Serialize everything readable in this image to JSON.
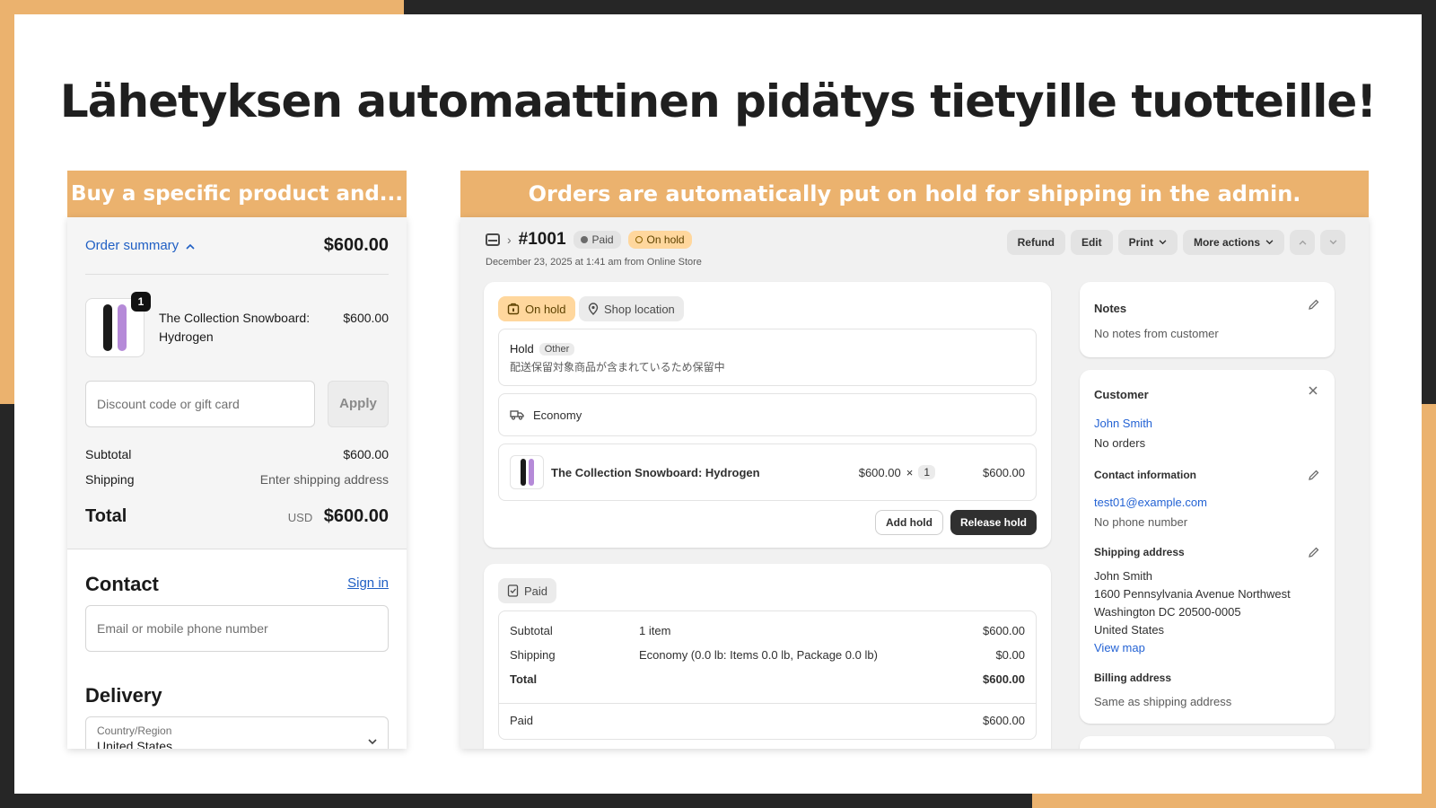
{
  "headline": "Lähetyksen automaattinen pidätys tietyille tuotteille!",
  "left_banner": "Buy a specific product and...",
  "right_banner": "Orders are automatically put on hold for shipping in the admin.",
  "colors": {
    "accent": "#EBB26E",
    "dark": "#262626",
    "link": "#2463d4"
  },
  "checkout": {
    "summary_label": "Order summary",
    "summary_total": "$600.00",
    "product": {
      "name": "The Collection Snowboard: Hydrogen",
      "price": "$600.00",
      "qty": "1"
    },
    "discount_placeholder": "Discount code or gift card",
    "apply_label": "Apply",
    "subtotal_label": "Subtotal",
    "subtotal_value": "$600.00",
    "shipping_label": "Shipping",
    "shipping_value": "Enter shipping address",
    "total_label": "Total",
    "total_currency": "USD",
    "total_value": "$600.00",
    "contact_title": "Contact",
    "sign_in": "Sign in",
    "email_placeholder": "Email or mobile phone number",
    "delivery_title": "Delivery",
    "country_label": "Country/Region",
    "country_value": "United States"
  },
  "admin": {
    "order_number": "#1001",
    "paid_badge": "Paid",
    "hold_badge": "On hold",
    "order_date": "December 23, 2025 at 1:41 am from Online Store",
    "actions": {
      "refund": "Refund",
      "edit": "Edit",
      "print": "Print",
      "more": "More actions"
    },
    "hold_card": {
      "on_hold_tag": "On hold",
      "location_tag": "Shop location",
      "hold_label": "Hold",
      "hold_type": "Other",
      "hold_reason": "配送保留対象商品が含まれているため保留中",
      "shipping_method": "Economy",
      "item_name": "The Collection Snowboard: Hydrogen",
      "item_price": "$600.00",
      "item_times": "×",
      "item_qty": "1",
      "item_total": "$600.00",
      "add_hold": "Add hold",
      "release_hold": "Release hold"
    },
    "payment_card": {
      "tag": "Paid",
      "subtotal_label": "Subtotal",
      "subtotal_desc": "1 item",
      "subtotal_value": "$600.00",
      "shipping_label": "Shipping",
      "shipping_desc": "Economy (0.0 lb: Items 0.0 lb, Package 0.0 lb)",
      "shipping_value": "$0.00",
      "total_label": "Total",
      "total_value": "$600.00",
      "paid_label": "Paid",
      "paid_value": "$600.00"
    },
    "notes": {
      "title": "Notes",
      "text": "No notes from customer"
    },
    "customer": {
      "title": "Customer",
      "name": "John Smith",
      "orders": "No orders",
      "contact_title": "Contact information",
      "email": "test01@example.com",
      "phone": "No phone number",
      "shipping_title": "Shipping address",
      "address_name": "John Smith",
      "address_line1": "1600 Pennsylvania Avenue Northwest",
      "address_line2": "Washington DC 20500-0005",
      "address_country": "United States",
      "view_map": "View map",
      "billing_title": "Billing address",
      "billing_text": "Same as shipping address"
    }
  }
}
